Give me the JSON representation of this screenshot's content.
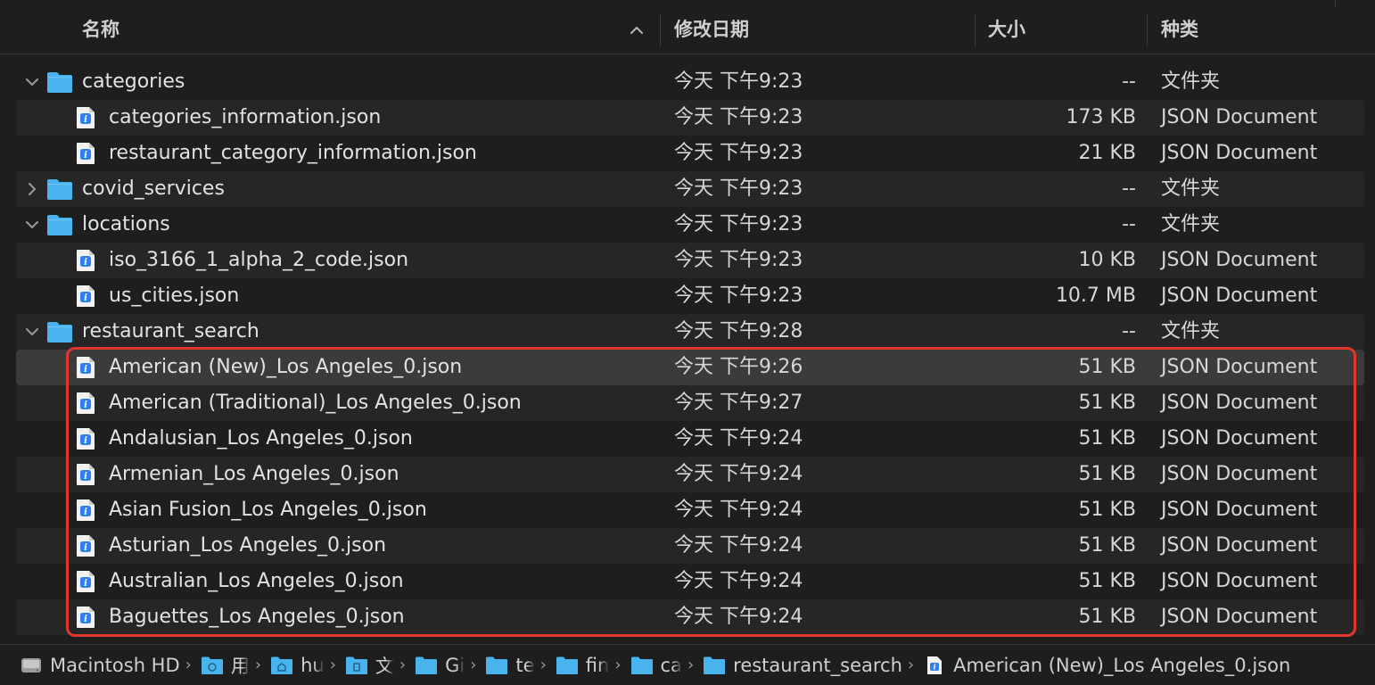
{
  "header": {
    "name": "名称",
    "date": "修改日期",
    "size": "大小",
    "kind": "种类"
  },
  "colors": {
    "folder": "#49b3ee",
    "highlight": "#e0362c",
    "selected_row": "#3b3b3b"
  },
  "rows": [
    {
      "type": "folder",
      "expanded": true,
      "name": "categories",
      "date": "今天 下午9:23",
      "size": "--",
      "kind": "文件夹"
    },
    {
      "type": "file",
      "name": "categories_information.json",
      "date": "今天 下午9:23",
      "size": "173 KB",
      "kind": "JSON Document"
    },
    {
      "type": "file",
      "name": "restaurant_category_information.json",
      "date": "今天 下午9:23",
      "size": "21 KB",
      "kind": "JSON Document"
    },
    {
      "type": "folder",
      "expanded": false,
      "name": "covid_services",
      "date": "今天 下午9:23",
      "size": "--",
      "kind": "文件夹"
    },
    {
      "type": "folder",
      "expanded": true,
      "name": "locations",
      "date": "今天 下午9:23",
      "size": "--",
      "kind": "文件夹"
    },
    {
      "type": "file",
      "name": "iso_3166_1_alpha_2_code.json",
      "date": "今天 下午9:23",
      "size": "10 KB",
      "kind": "JSON Document"
    },
    {
      "type": "file",
      "name": "us_cities.json",
      "date": "今天 下午9:23",
      "size": "10.7 MB",
      "kind": "JSON Document"
    },
    {
      "type": "folder",
      "expanded": true,
      "name": "restaurant_search",
      "date": "今天 下午9:28",
      "size": "--",
      "kind": "文件夹"
    },
    {
      "type": "file",
      "selected": true,
      "name": "American (New)_Los Angeles_0.json",
      "date": "今天 下午9:26",
      "size": "51 KB",
      "kind": "JSON Document"
    },
    {
      "type": "file",
      "name": "American (Traditional)_Los Angeles_0.json",
      "date": "今天 下午9:27",
      "size": "51 KB",
      "kind": "JSON Document"
    },
    {
      "type": "file",
      "name": "Andalusian_Los Angeles_0.json",
      "date": "今天 下午9:24",
      "size": "51 KB",
      "kind": "JSON Document"
    },
    {
      "type": "file",
      "name": "Armenian_Los Angeles_0.json",
      "date": "今天 下午9:24",
      "size": "51 KB",
      "kind": "JSON Document"
    },
    {
      "type": "file",
      "name": "Asian Fusion_Los Angeles_0.json",
      "date": "今天 下午9:24",
      "size": "51 KB",
      "kind": "JSON Document"
    },
    {
      "type": "file",
      "name": "Asturian_Los Angeles_0.json",
      "date": "今天 下午9:24",
      "size": "51 KB",
      "kind": "JSON Document"
    },
    {
      "type": "file",
      "name": "Australian_Los Angeles_0.json",
      "date": "今天 下午9:24",
      "size": "51 KB",
      "kind": "JSON Document"
    },
    {
      "type": "file",
      "name": "Baguettes_Los Angeles_0.json",
      "date": "今天 下午9:24",
      "size": "51 KB",
      "kind": "JSON Document"
    }
  ],
  "pathbar": [
    {
      "icon": "disk-icon",
      "label": "Macintosh HD",
      "truncated": false
    },
    {
      "icon": "user-folder-icon",
      "label": "用",
      "truncated": true
    },
    {
      "icon": "home-folder-icon",
      "label": "hu",
      "truncated": true
    },
    {
      "icon": "documents-folder-icon",
      "label": "文",
      "truncated": true
    },
    {
      "icon": "folder-icon",
      "label": "Gi",
      "truncated": true
    },
    {
      "icon": "folder-icon",
      "label": "te",
      "truncated": true
    },
    {
      "icon": "folder-icon",
      "label": "fin",
      "truncated": true
    },
    {
      "icon": "folder-icon",
      "label": "ca",
      "truncated": true
    },
    {
      "icon": "folder-icon",
      "label": "restaurant_search",
      "truncated": false
    },
    {
      "icon": "json-file-icon",
      "label": "American (New)_Los Angeles_0.json",
      "truncated": false
    }
  ]
}
